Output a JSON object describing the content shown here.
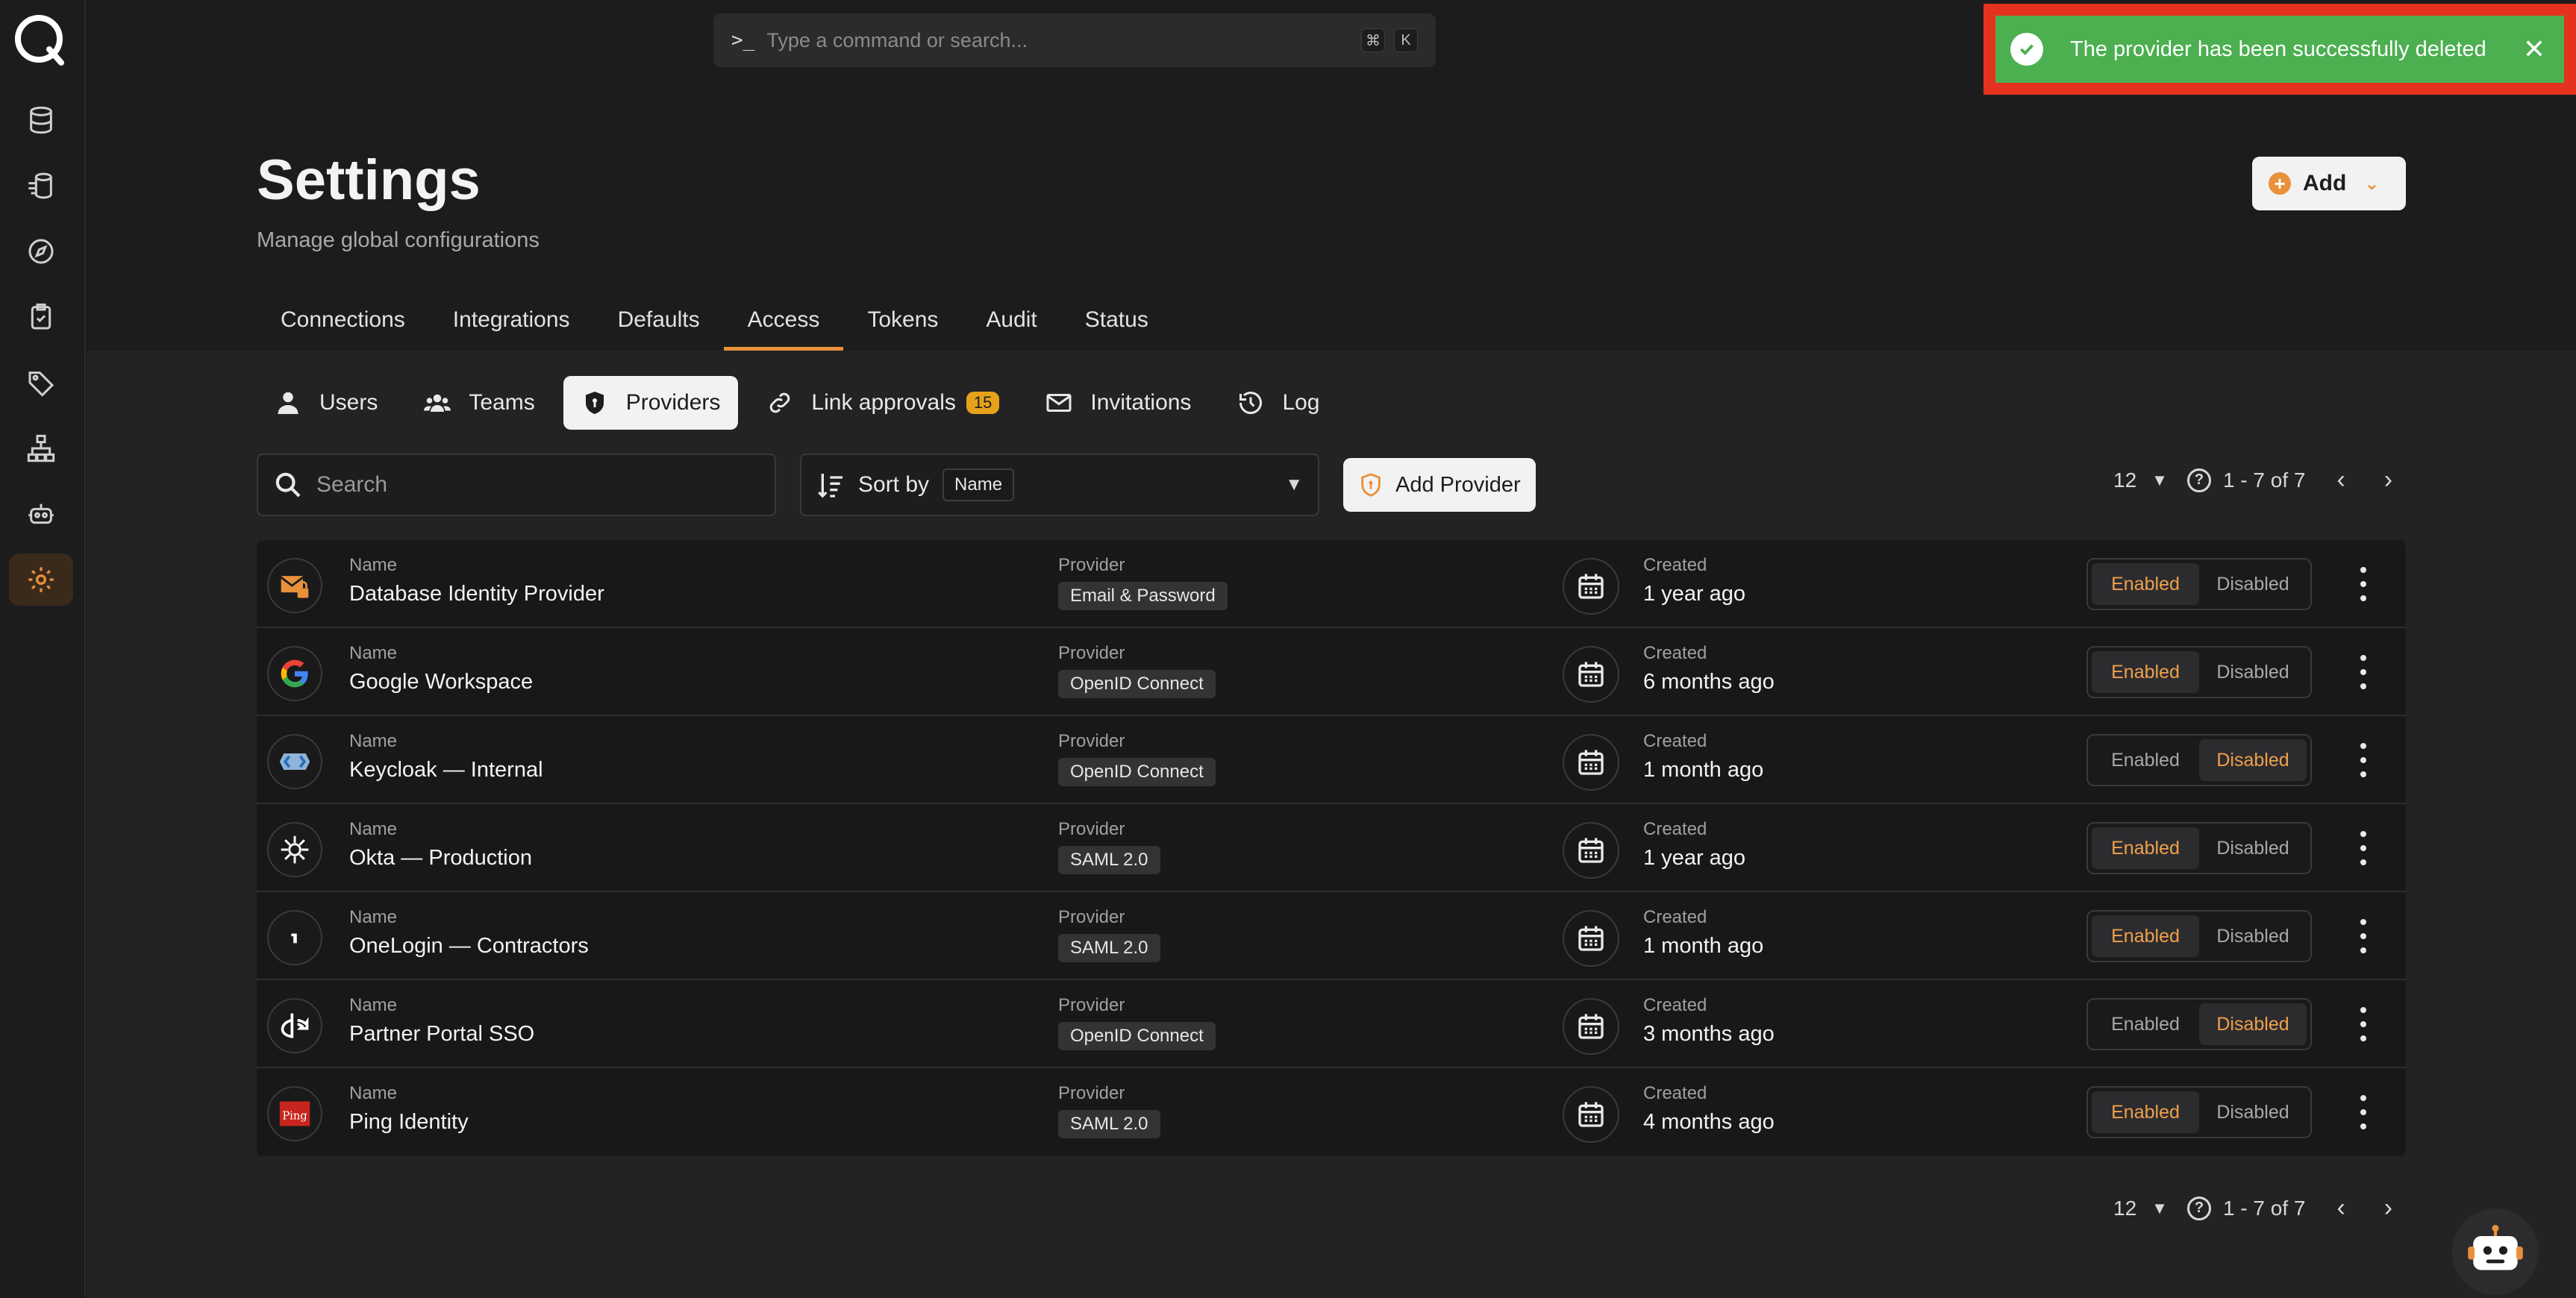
{
  "command_bar": {
    "prompt": ">_",
    "placeholder": "Type a command or search...",
    "keys": [
      "⌘",
      "K"
    ]
  },
  "toast": {
    "message": "The provider has been successfully deleted",
    "close": "✕"
  },
  "header": {
    "title": "Settings",
    "subtitle": "Manage global configurations",
    "add_label": "Add"
  },
  "tabs": [
    {
      "label": "Connections",
      "active": false
    },
    {
      "label": "Integrations",
      "active": false
    },
    {
      "label": "Defaults",
      "active": false
    },
    {
      "label": "Access",
      "active": true
    },
    {
      "label": "Tokens",
      "active": false
    },
    {
      "label": "Audit",
      "active": false
    },
    {
      "label": "Status",
      "active": false
    }
  ],
  "subtabs": [
    {
      "label": "Users",
      "icon": "user-icon",
      "active": false
    },
    {
      "label": "Teams",
      "icon": "team-icon",
      "active": false
    },
    {
      "label": "Providers",
      "icon": "shield-icon",
      "active": true
    },
    {
      "label": "Link approvals",
      "icon": "link-icon",
      "active": false,
      "badge": "15"
    },
    {
      "label": "Invitations",
      "icon": "mail-icon",
      "active": false
    },
    {
      "label": "Log",
      "icon": "history-icon",
      "active": false
    }
  ],
  "toolbar": {
    "search_placeholder": "Search",
    "sort_label": "Sort by",
    "sort_value": "Name",
    "add_provider_label": "Add Provider"
  },
  "pagination": {
    "per_page": "12",
    "range": "1 - 7 of 7"
  },
  "table": {
    "name_label": "Name",
    "provider_label": "Provider",
    "created_label": "Created",
    "enabled_label": "Enabled",
    "disabled_label": "Disabled",
    "rows": [
      {
        "name": "Database Identity Provider",
        "provider": "Email & Password",
        "created": "1 year ago",
        "enabled": true,
        "icon": "email-lock-icon"
      },
      {
        "name": "Google Workspace",
        "provider": "OpenID Connect",
        "created": "6 months ago",
        "enabled": true,
        "icon": "google-icon"
      },
      {
        "name": "Keycloak — Internal",
        "provider": "OpenID Connect",
        "created": "1 month ago",
        "enabled": false,
        "icon": "keycloak-icon"
      },
      {
        "name": "Okta — Production",
        "provider": "SAML 2.0",
        "created": "1 year ago",
        "enabled": true,
        "icon": "okta-icon"
      },
      {
        "name": "OneLogin — Contractors",
        "provider": "SAML 2.0",
        "created": "1 month ago",
        "enabled": true,
        "icon": "onelogin-icon"
      },
      {
        "name": "Partner Portal SSO",
        "provider": "OpenID Connect",
        "created": "3 months ago",
        "enabled": false,
        "icon": "openid-icon"
      },
      {
        "name": "Ping Identity",
        "provider": "SAML 2.0",
        "created": "4 months ago",
        "enabled": true,
        "icon": "ping-icon"
      }
    ]
  },
  "colors": {
    "accent": "#e8903a",
    "toast": "#4caf50",
    "highlight": "#e5321f",
    "badge": "#e5a21a"
  }
}
